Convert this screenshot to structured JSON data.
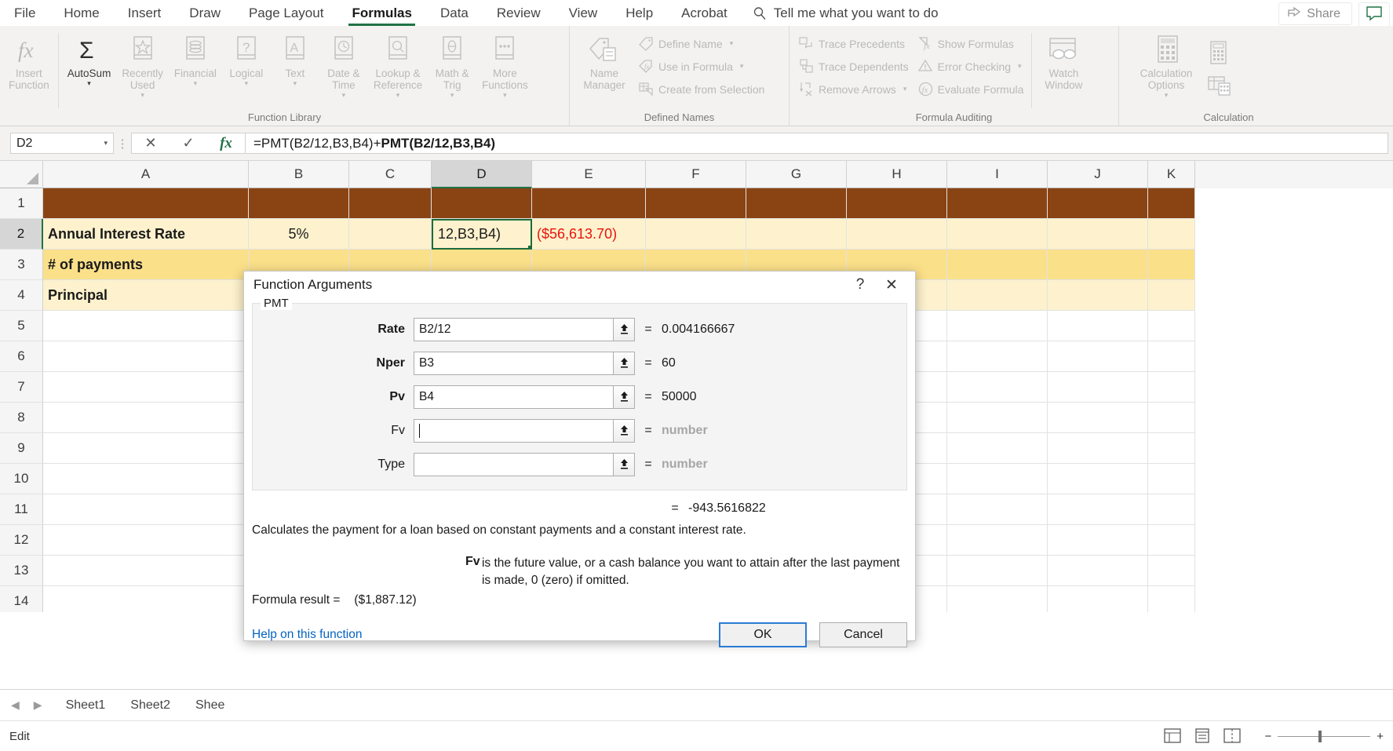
{
  "ribbon": {
    "tabs": [
      {
        "label": "File",
        "active": false
      },
      {
        "label": "Home",
        "active": false
      },
      {
        "label": "Insert",
        "active": false
      },
      {
        "label": "Draw",
        "active": false
      },
      {
        "label": "Page Layout",
        "active": false
      },
      {
        "label": "Formulas",
        "active": true
      },
      {
        "label": "Data",
        "active": false
      },
      {
        "label": "Review",
        "active": false
      },
      {
        "label": "View",
        "active": false
      },
      {
        "label": "Help",
        "active": false
      },
      {
        "label": "Acrobat",
        "active": false
      }
    ],
    "tellme": "Tell me what you want to do",
    "share_label": "Share",
    "groups": [
      {
        "title": "Function Library",
        "buttons": [
          {
            "label": "Insert\nFunction",
            "icon": "fx-icon",
            "caret": false,
            "enabled": false
          },
          {
            "label": "AutoSum",
            "icon": "sigma-icon",
            "caret": true,
            "enabled": true
          },
          {
            "label": "Recently\nUsed",
            "icon": "star-book-icon",
            "caret": true,
            "enabled": false
          },
          {
            "label": "Financial",
            "icon": "coins-book-icon",
            "caret": true,
            "enabled": false
          },
          {
            "label": "Logical",
            "icon": "question-book-icon",
            "caret": true,
            "enabled": false
          },
          {
            "label": "Text",
            "icon": "letter-a-book-icon",
            "caret": true,
            "enabled": false
          },
          {
            "label": "Date &\nTime",
            "icon": "clock-book-icon",
            "caret": true,
            "enabled": false
          },
          {
            "label": "Lookup &\nReference",
            "icon": "magnifier-book-icon",
            "caret": true,
            "enabled": false
          },
          {
            "label": "Math &\nTrig",
            "icon": "theta-book-icon",
            "caret": true,
            "enabled": false
          },
          {
            "label": "More\nFunctions",
            "icon": "ellipsis-book-icon",
            "caret": true,
            "enabled": false
          }
        ]
      },
      {
        "title": "Defined Names",
        "big": {
          "label": "Name\nManager",
          "icon": "name-manager-icon"
        },
        "items": [
          {
            "label": "Define Name",
            "icon": "tag-icon",
            "caret": true
          },
          {
            "label": "Use in Formula",
            "icon": "tag-fx-icon",
            "caret": true
          },
          {
            "label": "Create from Selection",
            "icon": "create-selection-icon",
            "caret": false
          }
        ]
      },
      {
        "title": "Formula Auditing",
        "col1": [
          {
            "label": "Trace Precedents",
            "icon": "trace-precedents-icon",
            "caret": false
          },
          {
            "label": "Trace Dependents",
            "icon": "trace-dependents-icon",
            "caret": false
          },
          {
            "label": "Remove Arrows",
            "icon": "remove-arrows-icon",
            "caret": true
          }
        ],
        "col2": [
          {
            "label": "Show Formulas",
            "icon": "show-formulas-icon",
            "caret": false
          },
          {
            "label": "Error Checking",
            "icon": "error-checking-icon",
            "caret": true
          },
          {
            "label": "Evaluate Formula",
            "icon": "evaluate-formula-icon",
            "caret": false
          }
        ],
        "watch": {
          "label": "Watch\nWindow",
          "icon": "watch-window-icon"
        }
      },
      {
        "title": "Calculation",
        "big": {
          "label": "Calculation\nOptions",
          "icon": "calculator-icon",
          "caret": true
        },
        "items": [
          {
            "icon": "calculate-now-icon"
          },
          {
            "icon": "calculate-sheet-icon"
          }
        ]
      }
    ]
  },
  "formula_bar": {
    "name_box": "D2",
    "cancel_icon": "cancel-icon",
    "enter_icon": "enter-icon",
    "fx_icon": "insert-function-icon",
    "formula_plain": "=PMT(B2/12,B3,B4)+",
    "formula_bold": "PMT(B2/12,B3,B4)"
  },
  "grid": {
    "columns": [
      "A",
      "B",
      "C",
      "D",
      "E",
      "F",
      "G",
      "H",
      "I",
      "J",
      "K"
    ],
    "selected_column": "D",
    "selected_row": "2",
    "rows": [
      {
        "num": "1",
        "fill": "#8a4413",
        "cells": []
      },
      {
        "num": "2",
        "fill": "#fdf2cd",
        "cells": [
          {
            "col": "A",
            "value": "Annual Interest Rate",
            "bold": true
          },
          {
            "col": "B",
            "value": "5%",
            "align": "center"
          },
          {
            "col": "D",
            "value": "12,B3,B4)",
            "editing": true
          },
          {
            "col": "E",
            "value": "($56,613.70)",
            "color": "red"
          }
        ]
      },
      {
        "num": "3",
        "fill": "#fbe08a",
        "cells": [
          {
            "col": "A",
            "value": "# of payments",
            "bold": true
          }
        ]
      },
      {
        "num": "4",
        "fill": "#fdf2cd",
        "cells": [
          {
            "col": "A",
            "value": "Principal",
            "bold": true
          }
        ]
      },
      {
        "num": "5",
        "fill": "",
        "cells": []
      },
      {
        "num": "6",
        "fill": "",
        "cells": []
      },
      {
        "num": "7",
        "fill": "",
        "cells": []
      },
      {
        "num": "8",
        "fill": "",
        "cells": []
      },
      {
        "num": "9",
        "fill": "",
        "cells": []
      },
      {
        "num": "10",
        "fill": "",
        "cells": []
      },
      {
        "num": "11",
        "fill": "",
        "cells": []
      },
      {
        "num": "12",
        "fill": "",
        "cells": []
      },
      {
        "num": "13",
        "fill": "",
        "cells": []
      },
      {
        "num": "14",
        "fill": "",
        "cells": []
      }
    ]
  },
  "dialog": {
    "title": "Function Arguments",
    "help_icon": "question-mark-icon",
    "close_icon": "close-icon",
    "function_name": "PMT",
    "args": [
      {
        "label": "Rate",
        "required": true,
        "value": "B2/12",
        "placeholder": "",
        "result": "0.004166667",
        "result_is_placeholder": false,
        "focused": false
      },
      {
        "label": "Nper",
        "required": true,
        "value": "B3",
        "placeholder": "",
        "result": "60",
        "result_is_placeholder": false,
        "focused": false
      },
      {
        "label": "Pv",
        "required": true,
        "value": "B4",
        "placeholder": "",
        "result": "50000",
        "result_is_placeholder": false,
        "focused": false
      },
      {
        "label": "Fv",
        "required": false,
        "value": "",
        "placeholder": "",
        "result": "number",
        "result_is_placeholder": true,
        "focused": true
      },
      {
        "label": "Type",
        "required": false,
        "value": "",
        "placeholder": "",
        "result": "number",
        "result_is_placeholder": true,
        "focused": false
      }
    ],
    "eq_symbol": "=",
    "overall_result": "-943.5616822",
    "description": "Calculates the payment for a loan based on constant payments and a constant interest rate.",
    "arg_help_key": "Fv",
    "arg_help_text": "is the future value, or a cash balance you want to attain after the last payment is made, 0 (zero) if omitted.",
    "formula_result_label": "Formula result  =",
    "formula_result_value": "($1,887.12)",
    "help_link": "Help on this function",
    "ok_label": "OK",
    "cancel_label": "Cancel"
  },
  "sheet_tabs": {
    "prev_icon": "prev-sheet-icon",
    "next_icon": "next-sheet-icon",
    "tabs": [
      {
        "label": "Sheet1",
        "active": false
      },
      {
        "label": "Sheet2",
        "active": false
      },
      {
        "label": "Shee",
        "active": false
      }
    ]
  },
  "status_bar": {
    "mode": "Edit",
    "view_normal_icon": "normal-view-icon",
    "view_layout_icon": "page-layout-view-icon",
    "view_break_icon": "page-break-view-icon",
    "zoom_out_icon": "zoom-out-icon",
    "zoom_in_icon": "zoom-in-icon"
  },
  "colors": {
    "accent_green": "#217346",
    "row1_fill": "#8a4413",
    "row_light": "#fdf2cd",
    "row_mid": "#fbe08a",
    "negative_red": "#e8140c"
  }
}
